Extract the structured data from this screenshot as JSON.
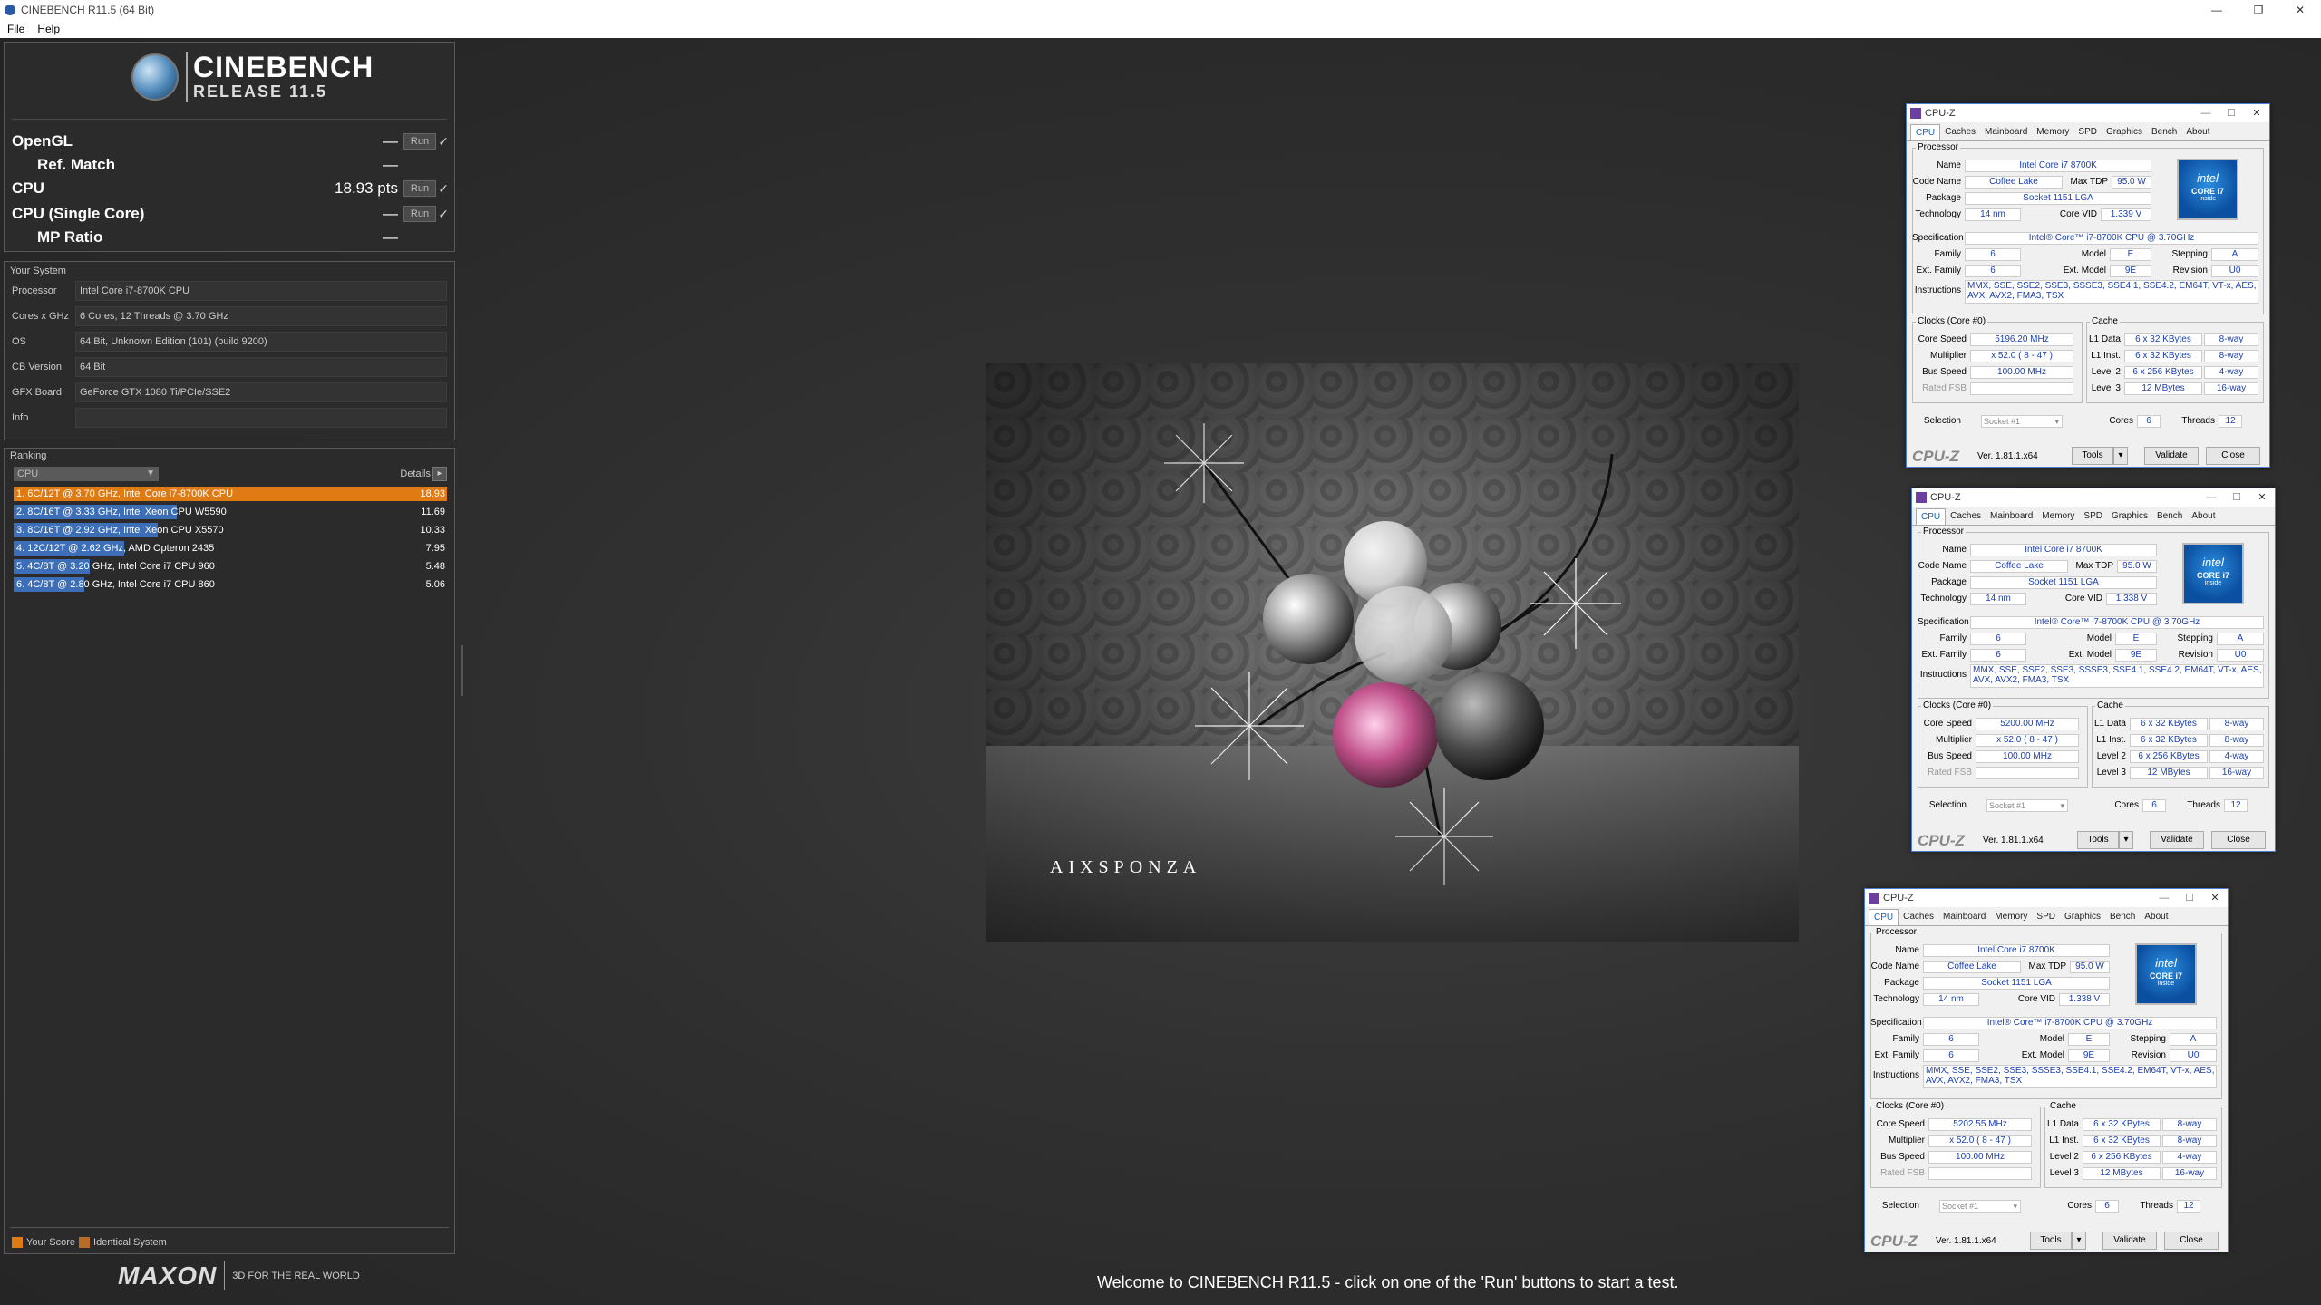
{
  "window": {
    "title": "CINEBENCH R11.5 (64 Bit)",
    "controls": [
      "—",
      "❐",
      "✕"
    ]
  },
  "menu": [
    "File",
    "Help"
  ],
  "logo": {
    "name": "CINEBENCH",
    "release": "RELEASE 11.5"
  },
  "benchmarks": [
    {
      "label": "OpenGL",
      "value": "—",
      "run": "Run",
      "check": "✓",
      "sub": false
    },
    {
      "label": "Ref. Match",
      "value": "—",
      "sub": true
    },
    {
      "label": "CPU",
      "value": "18.93 pts",
      "run": "Run",
      "check": "✓",
      "sub": false
    },
    {
      "label": "CPU (Single Core)",
      "value": "—",
      "run": "Run",
      "check": "✓",
      "sub": false
    },
    {
      "label": "MP Ratio",
      "value": "—",
      "sub": true
    }
  ],
  "system": {
    "title": "Your System",
    "rows": [
      {
        "k": "Processor",
        "v": "Intel Core i7-8700K CPU"
      },
      {
        "k": "Cores x GHz",
        "v": "6 Cores, 12 Threads @ 3.70 GHz"
      },
      {
        "k": "OS",
        "v": "64 Bit, Unknown Edition (101) (build 9200)"
      },
      {
        "k": "CB Version",
        "v": "64 Bit"
      },
      {
        "k": "GFX Board",
        "v": "GeForce GTX 1080 Ti/PCIe/SSE2"
      },
      {
        "k": "Info",
        "v": ""
      }
    ]
  },
  "ranking": {
    "title": "Ranking",
    "select": "CPU",
    "details": "Details",
    "details_btn": "▸",
    "max_score": 18.93,
    "rows": [
      {
        "label": "1. 6C/12T @ 3.70 GHz, Intel Core i7-8700K CPU",
        "score": 18.93,
        "mine": true
      },
      {
        "label": "2. 8C/16T @ 3.33 GHz, Intel Xeon CPU W5590",
        "score": 11.69,
        "mine": false
      },
      {
        "label": "3. 8C/16T @ 2.92 GHz, Intel Xeon CPU X5570",
        "score": 10.33,
        "mine": false
      },
      {
        "label": "4. 12C/12T @ 2.62 GHz, AMD Opteron 2435",
        "score": 7.95,
        "mine": false
      },
      {
        "label": "5. 4C/8T @ 3.20 GHz, Intel Core i7 CPU 960",
        "score": 5.48,
        "mine": false
      },
      {
        "label": "6. 4C/8T @ 2.80 GHz, Intel Core i7 CPU 860",
        "score": 5.06,
        "mine": false
      }
    ],
    "legend": {
      "your_score": "Your Score",
      "identical": "Identical System"
    }
  },
  "footer": {
    "brand": "MAXON",
    "tagline": "3D FOR THE REAL WORLD",
    "welcome": "Welcome to CINEBENCH R11.5 - click on one of the 'Run' buttons to start a test."
  },
  "render": {
    "signature": "AIXSPONZA"
  },
  "colors": {
    "my_bar": "#e07a13",
    "other_bar": "#3d6fb8",
    "cpuz_value": "#1a3fb0"
  },
  "cpuz_common": {
    "title": "CPU-Z",
    "tabs": [
      "CPU",
      "Caches",
      "Mainboard",
      "Memory",
      "SPD",
      "Graphics",
      "Bench",
      "About"
    ],
    "processor_label": "Processor",
    "name_label": "Name",
    "name": "Intel Core i7 8700K",
    "codename_label": "Code Name",
    "codename": "Coffee Lake",
    "maxtdp_label": "Max TDP",
    "maxtdp": "95.0 W",
    "package_label": "Package",
    "package": "Socket 1151 LGA",
    "tech_label": "Technology",
    "tech": "14 nm",
    "corevid_label": "Core VID",
    "spec_label": "Specification",
    "spec": "Intel® Core™ i7-8700K CPU @ 3.70GHz",
    "family_label": "Family",
    "family": "6",
    "model_label": "Model",
    "model": "E",
    "stepping_label": "Stepping",
    "stepping": "A",
    "extfamily_label": "Ext. Family",
    "extfamily": "6",
    "extmodel_label": "Ext. Model",
    "extmodel": "9E",
    "revision_label": "Revision",
    "revision": "U0",
    "instr_label": "Instructions",
    "instr": "MMX, SSE, SSE2, SSE3, SSSE3, SSE4.1, SSE4.2, EM64T, VT-x, AES, AVX, AVX2, FMA3, TSX",
    "clocks_label": "Clocks (Core #0)",
    "corespeed_label": "Core Speed",
    "mult_label": "Multiplier",
    "bus_label": "Bus Speed",
    "bus": "100.00 MHz",
    "fsb_label": "Rated FSB",
    "cache_label": "Cache",
    "l1d_label": "L1 Data",
    "l1d": "6 x 32 KBytes",
    "l1d_way": "8-way",
    "l1i_label": "L1 Inst.",
    "l1i": "6 x 32 KBytes",
    "l1i_way": "8-way",
    "l2_label": "Level 2",
    "l2": "6 x 256 KBytes",
    "l2_way": "4-way",
    "l3_label": "Level 3",
    "l3": "12 MBytes",
    "l3_way": "16-way",
    "selection_label": "Selection",
    "selection": "Socket #1",
    "cores_label": "Cores",
    "cores": "6",
    "threads_label": "Threads",
    "threads": "12",
    "brand": "CPU-Z",
    "version": "Ver. 1.81.1.x64",
    "tools": "Tools",
    "validate": "Validate",
    "close": "Close",
    "intel_1": "intel",
    "intel_2": "CORE i7",
    "intel_3": "inside"
  },
  "cpuz_windows": [
    {
      "corevid": "1.339 V",
      "corespeed": "5196.20 MHz",
      "mult": "x 52.0 ( 8 - 47 )"
    },
    {
      "corevid": "1.338 V",
      "corespeed": "5200.00 MHz",
      "mult": "x 52.0 ( 8 - 47 )"
    },
    {
      "corevid": "1.338 V",
      "corespeed": "5202.55 MHz",
      "mult": "x 52.0 ( 8 - 47 )"
    }
  ]
}
